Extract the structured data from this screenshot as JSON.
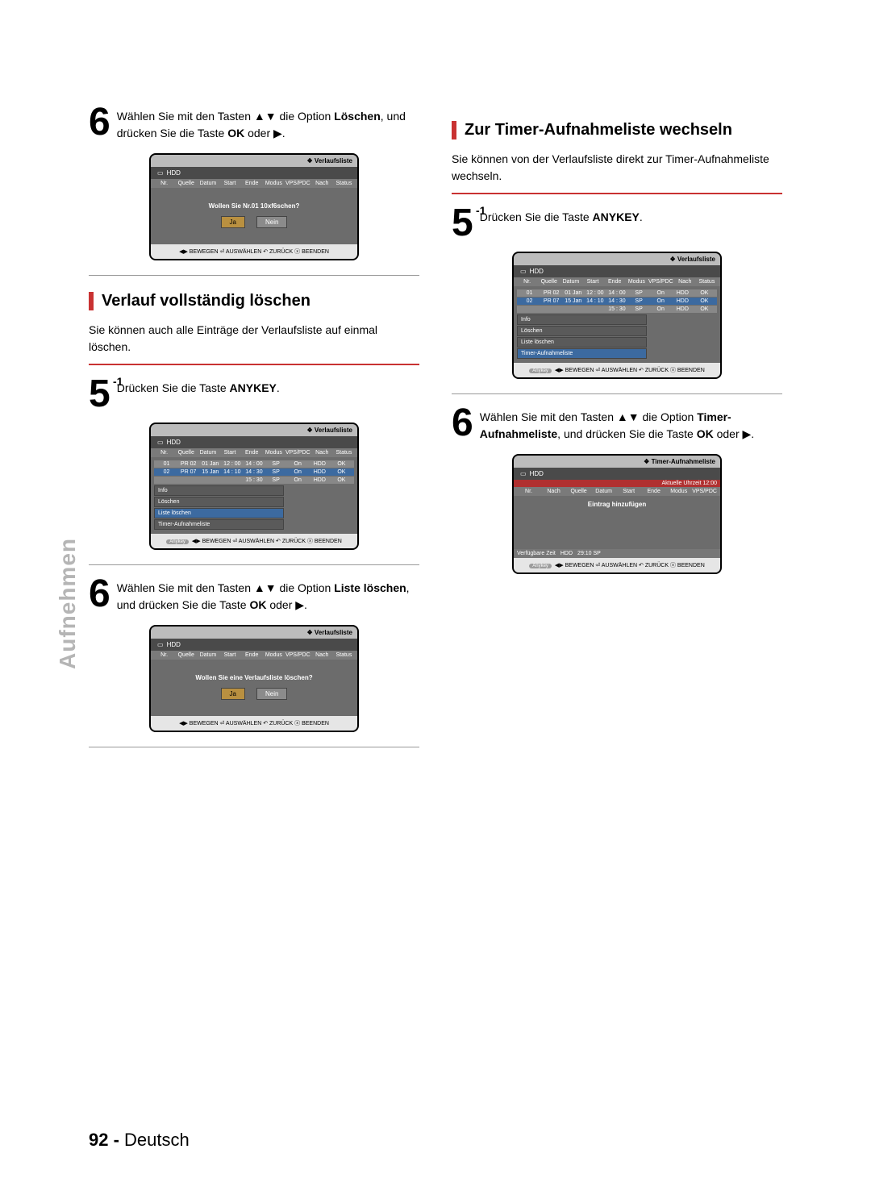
{
  "page_footer": {
    "num": "92 -",
    "lang": "Deutsch"
  },
  "side_label": "Aufnehmen",
  "left": {
    "step6a": "Wählen Sie mit den Tasten ▲▼ die Option <b>Löschen</b>, und drücken Sie die Taste <b>OK</b> oder ▶.",
    "osd1": {
      "title": "Verlaufsliste",
      "dev": "HDD",
      "cols": [
        "Nr.",
        "Quelle",
        "Datum",
        "Start",
        "Ende",
        "Modus",
        "VPS/PDC",
        "Nach",
        "Status"
      ],
      "dialog_msg": "Wollen Sie Nr.01 10xf6schen?",
      "yes": "Ja",
      "no": "Nein",
      "footer": "◀▶ BEWEGEN  ⏎ AUSWÄHLEN  ↶ ZURÜCK  ⓧ BEENDEN"
    },
    "sec1_head": "Verlauf vollständig löschen",
    "sec1_desc": "Sie können auch alle Einträge der Verlaufsliste auf einmal löschen.",
    "step51": "Drücken Sie die Taste <b>ANYKEY</b>.",
    "osd2": {
      "title": "Verlaufsliste",
      "dev": "HDD",
      "cols": [
        "Nr.",
        "Quelle",
        "Datum",
        "Start",
        "Ende",
        "Modus",
        "VPS/PDC",
        "Nach",
        "Status"
      ],
      "rows": [
        [
          "01",
          "PR 02",
          "01 Jan",
          "12 : 00",
          "14 : 00",
          "SP",
          "On",
          "HDD",
          "OK"
        ],
        [
          "02",
          "PR 07",
          "15 Jan",
          "14 : 10",
          "14 : 30",
          "SP",
          "On",
          "HDD",
          "OK"
        ],
        [
          "",
          "",
          "",
          "",
          "15 : 30",
          "SP",
          "On",
          "HDD",
          "OK"
        ]
      ],
      "menu": [
        "Info",
        "Löschen",
        "Liste löschen",
        "Timer-Aufnahmeliste"
      ],
      "menu_hi": 2,
      "footer_key": "Anykey",
      "footer": "◀▶ BEWEGEN  ⏎ AUSWÄHLEN  ↶ ZURÜCK  ⓧ BEENDEN"
    },
    "step6b": "Wählen Sie mit den Tasten ▲▼ die Option <b>Liste löschen</b>, und drücken Sie die Taste <b>OK</b> oder ▶.",
    "osd3": {
      "title": "Verlaufsliste",
      "dev": "HDD",
      "cols": [
        "Nr.",
        "Quelle",
        "Datum",
        "Start",
        "Ende",
        "Modus",
        "VPS/PDC",
        "Nach",
        "Status"
      ],
      "dialog_msg": "Wollen Sie eine Verlaufsliste löschen?",
      "yes": "Ja",
      "no": "Nein",
      "footer": "◀▶ BEWEGEN  ⏎ AUSWÄHLEN  ↶ ZURÜCK  ⓧ BEENDEN"
    }
  },
  "right": {
    "sec_head": "Zur Timer-Aufnahmeliste wechseln",
    "sec_desc": "Sie können von der Verlaufsliste direkt zur Timer-Aufnahmeliste wechseln.",
    "step51": "Drücken Sie die Taste <b>ANYKEY</b>.",
    "osd4": {
      "title": "Verlaufsliste",
      "dev": "HDD",
      "cols": [
        "Nr.",
        "Quelle",
        "Datum",
        "Start",
        "Ende",
        "Modus",
        "VPS/PDC",
        "Nach",
        "Status"
      ],
      "rows": [
        [
          "01",
          "PR 02",
          "01 Jan",
          "12 : 00",
          "14 : 00",
          "SP",
          "On",
          "HDD",
          "OK"
        ],
        [
          "02",
          "PR 07",
          "15 Jan",
          "14 : 10",
          "14 : 30",
          "SP",
          "On",
          "HDD",
          "OK"
        ],
        [
          "",
          "",
          "",
          "",
          "15 : 30",
          "SP",
          "On",
          "HDD",
          "OK"
        ]
      ],
      "menu": [
        "Info",
        "Löschen",
        "Liste löschen",
        "Timer-Aufnahmeliste"
      ],
      "menu_hi": 3,
      "footer_key": "Anykey",
      "footer": "◀▶ BEWEGEN  ⏎ AUSWÄHLEN  ↶ ZURÜCK  ⓧ BEENDEN"
    },
    "step6": "Wählen Sie mit den Tasten ▲▼ die Option <b>Timer-Aufnahmeliste</b>, und drücken Sie die Taste <b>OK</b> oder ▶.",
    "osd5": {
      "title": "Timer-Aufnahmeliste",
      "dev": "HDD",
      "red_bar": "Aktuelle Uhrzeit 12:00",
      "cols": [
        "Nr.",
        "Nach",
        "Quelle",
        "Datum",
        "Start",
        "Ende",
        "Modus",
        "VPS/PDC"
      ],
      "add": "Eintrag hinzufügen",
      "avail": {
        "label": "Verfügbare Zeit",
        "dev": "HDD",
        "val": "29:10 SP"
      },
      "footer_key": "Anykey",
      "footer": "◀▶ BEWEGEN  ⏎ AUSWÄHLEN  ↶ ZURÜCK  ⓧ BEENDEN"
    }
  }
}
